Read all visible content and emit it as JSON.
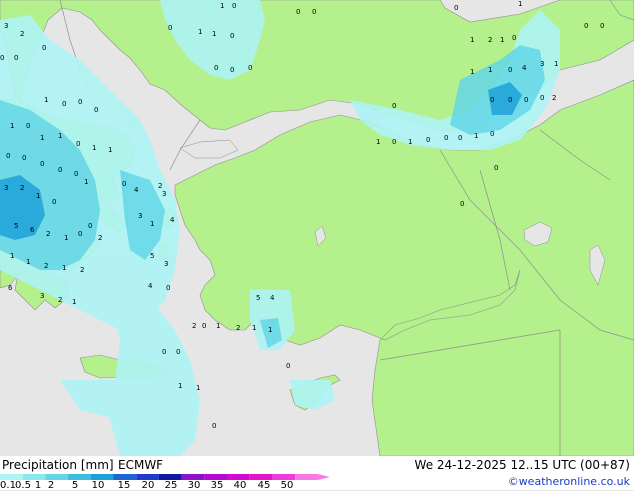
{
  "title": "Precipitation [mm]",
  "product": "ECMWF",
  "valid_time": "We 24-12-2025 12..15 UTC (00+87)",
  "credit": "©weatheronline.co.uk",
  "legend": {
    "labels": [
      "0.1",
      "0.5",
      "1",
      "2",
      "5",
      "10",
      "15",
      "20",
      "25",
      "30",
      "35",
      "40",
      "45",
      "50"
    ],
    "colors": [
      "#aef4f4",
      "#8ce8ec",
      "#64d6e6",
      "#3cbce0",
      "#1ea0d8",
      "#1e64d2",
      "#1e3cc8",
      "#1418a0",
      "#8c14c8",
      "#b40ad2",
      "#d20ad2",
      "#e614c8",
      "#f03cdc",
      "#f878e6"
    ]
  },
  "map": {
    "land_color": "#b4f08c",
    "sea_color": "#e6e6e6",
    "border_color": "#909090",
    "rain_light": "#aef4f4",
    "rain_mid": "#64d6e6",
    "rain_heavy": "#1ea0d8",
    "values": [
      {
        "v": "3"
      },
      {
        "v": "2"
      },
      {
        "v": "0"
      },
      {
        "v": "1"
      },
      {
        "v": "0"
      },
      {
        "v": "0"
      },
      {
        "v": "0"
      },
      {
        "v": "1"
      },
      {
        "v": "0"
      },
      {
        "v": "0"
      },
      {
        "v": "1"
      },
      {
        "v": "1"
      },
      {
        "v": "0"
      },
      {
        "v": "0"
      },
      {
        "v": "0"
      },
      {
        "v": "0"
      },
      {
        "v": "0"
      },
      {
        "v": "0"
      },
      {
        "v": "1"
      },
      {
        "v": "0"
      },
      {
        "v": "0"
      },
      {
        "v": "0"
      },
      {
        "v": "0"
      },
      {
        "v": "1"
      },
      {
        "v": "1"
      },
      {
        "v": "1"
      },
      {
        "v": "0"
      },
      {
        "v": "0"
      },
      {
        "v": "0"
      },
      {
        "v": "0"
      },
      {
        "v": "3"
      },
      {
        "v": "2"
      },
      {
        "v": "1"
      },
      {
        "v": "0"
      },
      {
        "v": "5"
      },
      {
        "v": "6"
      },
      {
        "v": "2"
      },
      {
        "v": "1"
      },
      {
        "v": "0"
      },
      {
        "v": "0"
      },
      {
        "v": "1"
      },
      {
        "v": "1"
      },
      {
        "v": "2"
      },
      {
        "v": "1"
      },
      {
        "v": "2"
      },
      {
        "v": "2"
      },
      {
        "v": "0"
      },
      {
        "v": "1"
      },
      {
        "v": "1"
      },
      {
        "v": "0"
      },
      {
        "v": "1"
      },
      {
        "v": "0"
      },
      {
        "v": "4"
      },
      {
        "v": "2"
      },
      {
        "v": "3"
      },
      {
        "v": "1"
      },
      {
        "v": "3"
      },
      {
        "v": "4"
      },
      {
        "v": "5"
      },
      {
        "v": "3"
      },
      {
        "v": "0"
      },
      {
        "v": "4"
      },
      {
        "v": "6"
      },
      {
        "v": "3"
      },
      {
        "v": "2"
      },
      {
        "v": "1"
      },
      {
        "v": "5"
      },
      {
        "v": "4"
      },
      {
        "v": "1"
      },
      {
        "v": "2"
      },
      {
        "v": "0"
      },
      {
        "v": "1"
      },
      {
        "v": "2"
      },
      {
        "v": "1"
      },
      {
        "v": "0"
      },
      {
        "v": "0"
      },
      {
        "v": "0"
      },
      {
        "v": "1"
      },
      {
        "v": "1"
      },
      {
        "v": "0"
      },
      {
        "v": "1"
      },
      {
        "v": "2"
      },
      {
        "v": "1"
      },
      {
        "v": "0"
      },
      {
        "v": "1"
      },
      {
        "v": "1"
      },
      {
        "v": "0"
      },
      {
        "v": "4"
      },
      {
        "v": "3"
      },
      {
        "v": "1"
      },
      {
        "v": "0"
      },
      {
        "v": "0"
      },
      {
        "v": "0"
      },
      {
        "v": "0"
      },
      {
        "v": "2"
      },
      {
        "v": "1"
      },
      {
        "v": "0"
      },
      {
        "v": "1"
      },
      {
        "v": "0"
      },
      {
        "v": "0"
      },
      {
        "v": "0"
      },
      {
        "v": "1"
      },
      {
        "v": "0"
      },
      {
        "v": "0"
      },
      {
        "v": "0"
      },
      {
        "v": "0"
      },
      {
        "v": "0"
      },
      {
        "v": "0"
      },
      {
        "v": "1"
      },
      {
        "v": "0"
      },
      {
        "v": "0"
      },
      {
        "v": "0"
      },
      {
        "v": "0"
      },
      {
        "v": "0"
      }
    ]
  }
}
